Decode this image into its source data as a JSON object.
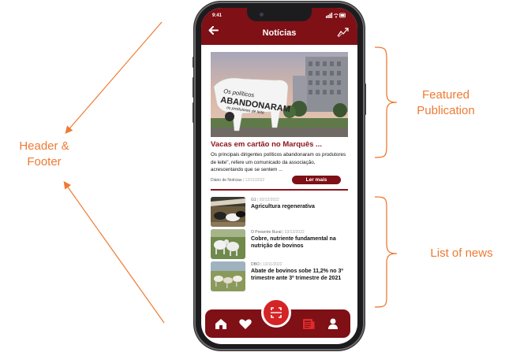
{
  "annotations": {
    "header_footer": "Header &\nFooter",
    "featured": "Featured\nPublication",
    "list": "List of news"
  },
  "status": {
    "time": "9:41",
    "icons": "signal-wifi-battery"
  },
  "header": {
    "title": "Notícias",
    "back_icon": "arrow-left-icon",
    "trend_icon": "trending-up-icon"
  },
  "featured": {
    "image_text_1": "Os políticos",
    "image_text_2": "ABANDONARAM",
    "image_text_3": "os produtores de leite",
    "title": "Vacas em cartão no Marquês ...",
    "description": "Os principais dirigentes políticos abandonaram os produtores de leite\", refere um comunicado da associação, acrescentando que se sentem ...",
    "source": "Diário de Notícias",
    "date": "12/11/2022",
    "button": "Ler mais"
  },
  "news": [
    {
      "source": "G1",
      "date": "03/12/2022",
      "title": "Agricultura regenerativa"
    },
    {
      "source": "O Presente Rural",
      "date": "03/12/2022",
      "title": "Cobre, nutriente fundamental na nutrição de bovinos"
    },
    {
      "source": "DBO",
      "date": "13/11/2022",
      "title": "Abate de bovinos sobe 11,2% no 3º trimestre ante 3º trimestre de 2021"
    }
  ],
  "nav": {
    "items": [
      "home-icon",
      "heart-icon",
      "scan-icon",
      "newspaper-icon",
      "user-icon"
    ],
    "active": "newspaper-icon"
  },
  "colors": {
    "primary": "#7f1016",
    "accent": "#d42426",
    "annotation": "#ee7a33"
  }
}
